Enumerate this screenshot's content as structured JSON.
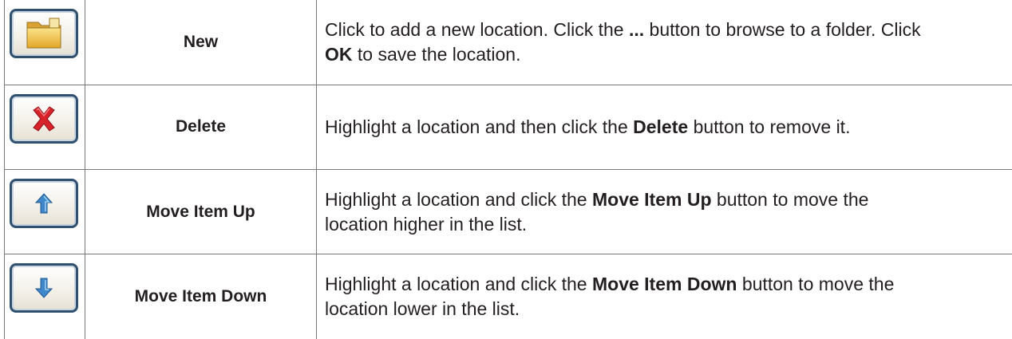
{
  "rows": [
    {
      "icon": "new-folder-icon",
      "name": "New",
      "desc_line1": {
        "a": "Click to add a new location. Click the ",
        "b": "...",
        "c": " button to browse to a folder. Click"
      },
      "desc_line2": {
        "a": "",
        "b": "OK",
        "c": " to save the location."
      }
    },
    {
      "icon": "delete-x-icon",
      "name": "Delete",
      "desc_line1": {
        "a": "Highlight a location and then click the ",
        "b": "Delete",
        "c": " button to remove it."
      }
    },
    {
      "icon": "arrow-up-icon",
      "name": "Move Item Up",
      "desc_line1": {
        "a": "Highlight a location and click the ",
        "b": "Move Item Up",
        "c": " button to move the"
      },
      "desc_line2": {
        "a": "location higher in the list.",
        "b": "",
        "c": ""
      }
    },
    {
      "icon": "arrow-down-icon",
      "name": "Move Item Down",
      "desc_line1": {
        "a": "Highlight a location and click the ",
        "b": "Move Item Down",
        "c": " button to move the"
      },
      "desc_line2": {
        "a": "location lower in the list.",
        "b": "",
        "c": ""
      }
    }
  ],
  "colors": {
    "border": "#7a7a7a",
    "button_border": "#30506f",
    "folder": "#f0c040",
    "delete_red": "#d8232a",
    "arrow_blue": "#3f87c8"
  }
}
